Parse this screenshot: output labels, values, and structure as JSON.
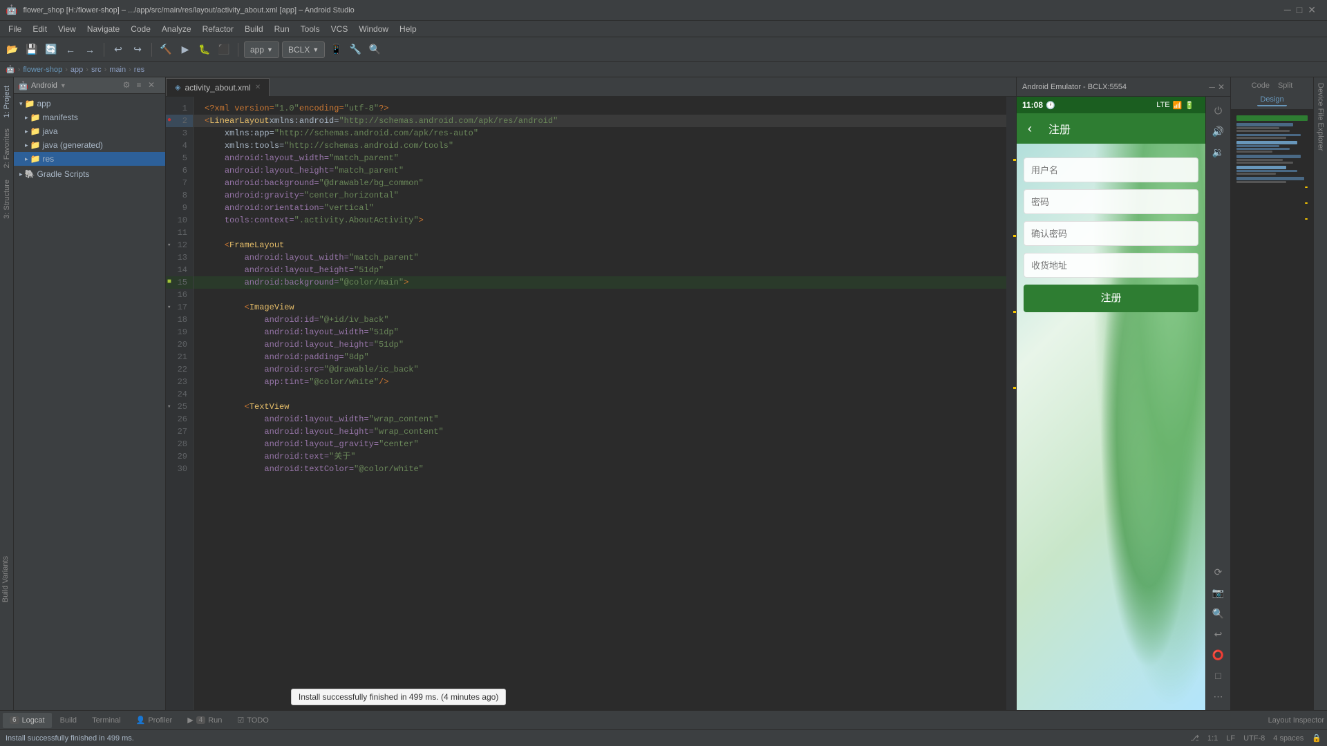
{
  "window": {
    "title": "flower_shop [H:/flower-shop] – .../app/src/main/res/layout/activity_about.xml [app] – Android Studio",
    "minimize": "–",
    "maximize": "□",
    "close": "✕"
  },
  "menubar": {
    "items": [
      "File",
      "Edit",
      "View",
      "Navigate",
      "Code",
      "Analyze",
      "Refactor",
      "Build",
      "Run",
      "Tools",
      "VCS",
      "Window",
      "Help"
    ]
  },
  "toolbar": {
    "app_config": "app",
    "bclx": "BCLX"
  },
  "breadcrumb": {
    "items": [
      "flower-shop",
      "app",
      "src",
      "main",
      "res"
    ],
    "separator": "›"
  },
  "project_panel": {
    "title": "Android",
    "items": [
      {
        "label": "app",
        "indent": 0,
        "type": "folder"
      },
      {
        "label": "manifests",
        "indent": 1,
        "type": "folder"
      },
      {
        "label": "java",
        "indent": 1,
        "type": "folder"
      },
      {
        "label": "java (generated)",
        "indent": 1,
        "type": "folder"
      },
      {
        "label": "res",
        "indent": 1,
        "type": "folder",
        "selected": true
      },
      {
        "label": "Gradle Scripts",
        "indent": 0,
        "type": "gradle"
      }
    ]
  },
  "editor": {
    "tab_label": "activity_about.xml",
    "lines": [
      {
        "num": 1,
        "content": "<?xml version=\"1.0\" encoding=\"utf-8\"?>"
      },
      {
        "num": 2,
        "content": "<LinearLayout xmlns:android=\"http://schemas.android.com/apk/res/android\"",
        "highlight": true,
        "gutter": "circle"
      },
      {
        "num": 3,
        "content": "    xmlns:app=\"http://schemas.android.com/apk/res-auto\""
      },
      {
        "num": 4,
        "content": "    xmlns:tools=\"http://schemas.android.com/tools\""
      },
      {
        "num": 5,
        "content": "    android:layout_width=\"match_parent\""
      },
      {
        "num": 6,
        "content": "    android:layout_height=\"match_parent\""
      },
      {
        "num": 7,
        "content": "    android:background=\"@drawable/bg_common\""
      },
      {
        "num": 8,
        "content": "    android:gravity=\"center_horizontal\""
      },
      {
        "num": 9,
        "content": "    android:orientation=\"vertical\""
      },
      {
        "num": 10,
        "content": "    tools:context=\".activity.AboutActivity\">"
      },
      {
        "num": 11,
        "content": ""
      },
      {
        "num": 12,
        "content": "    <FrameLayout",
        "foldable": true
      },
      {
        "num": 13,
        "content": "        android:layout_width=\"match_parent\""
      },
      {
        "num": 14,
        "content": "        android:layout_height=\"51dp\""
      },
      {
        "num": 15,
        "content": "        android:background=\"@color/main\">",
        "gutter": "square"
      },
      {
        "num": 16,
        "content": ""
      },
      {
        "num": 17,
        "content": "        <ImageView",
        "foldable": true
      },
      {
        "num": 18,
        "content": "            android:id=\"@+id/iv_back\""
      },
      {
        "num": 19,
        "content": "            android:layout_width=\"51dp\""
      },
      {
        "num": 20,
        "content": "            android:layout_height=\"51dp\""
      },
      {
        "num": 21,
        "content": "            android:padding=\"8dp\""
      },
      {
        "num": 22,
        "content": "            android:src=\"@drawable/ic_back\""
      },
      {
        "num": 23,
        "content": "            app:tint=\"@color/white\" />"
      },
      {
        "num": 24,
        "content": ""
      },
      {
        "num": 25,
        "content": "        <TextView",
        "foldable": true
      },
      {
        "num": 26,
        "content": "            android:layout_width=\"wrap_content\""
      },
      {
        "num": 27,
        "content": "            android:layout_height=\"wrap_content\""
      },
      {
        "num": 28,
        "content": "            android:layout_gravity=\"center\""
      },
      {
        "num": 29,
        "content": "            android:text=\"关于\""
      },
      {
        "num": 30,
        "content": "            android:textColor=\"@color/white\""
      }
    ]
  },
  "emulator": {
    "title": "Android Emulator - BCLX:5554",
    "phone": {
      "time": "11:08",
      "network": "LTE",
      "page_title": "注册",
      "form": {
        "username_placeholder": "用户名",
        "password_placeholder": "密码",
        "confirm_password_placeholder": "确认密码",
        "address_placeholder": "收货地址",
        "submit_label": "注册"
      }
    }
  },
  "right_panel": {
    "tabs": [
      "Code",
      "Split",
      "Design"
    ]
  },
  "bottom_tabs": [
    {
      "label": "Logcat",
      "num": "6"
    },
    {
      "label": "Build",
      "num": ""
    },
    {
      "label": "Terminal",
      "num": ""
    },
    {
      "label": "Profiler",
      "num": ""
    },
    {
      "label": "Run",
      "num": "4"
    },
    {
      "label": "TODO",
      "num": ""
    }
  ],
  "statusbar": {
    "main_message": "Install successfully finished in 499 ms.",
    "tooltip": "Install successfully finished in 499 ms. (4 minutes ago)",
    "encoding": "UTF-8",
    "line_separator": "LF",
    "position": "1:1",
    "indent": "4 spaces"
  },
  "layout_inspector": "Layout Inspector",
  "sidebar_left": {
    "project_tab": "1: Project",
    "favorites_tab": "2: Favorites",
    "structure_tab": "3: Structure"
  },
  "sidebar_right": {
    "build_variants": "Build Variants",
    "device_file": "Device File Explorer"
  }
}
